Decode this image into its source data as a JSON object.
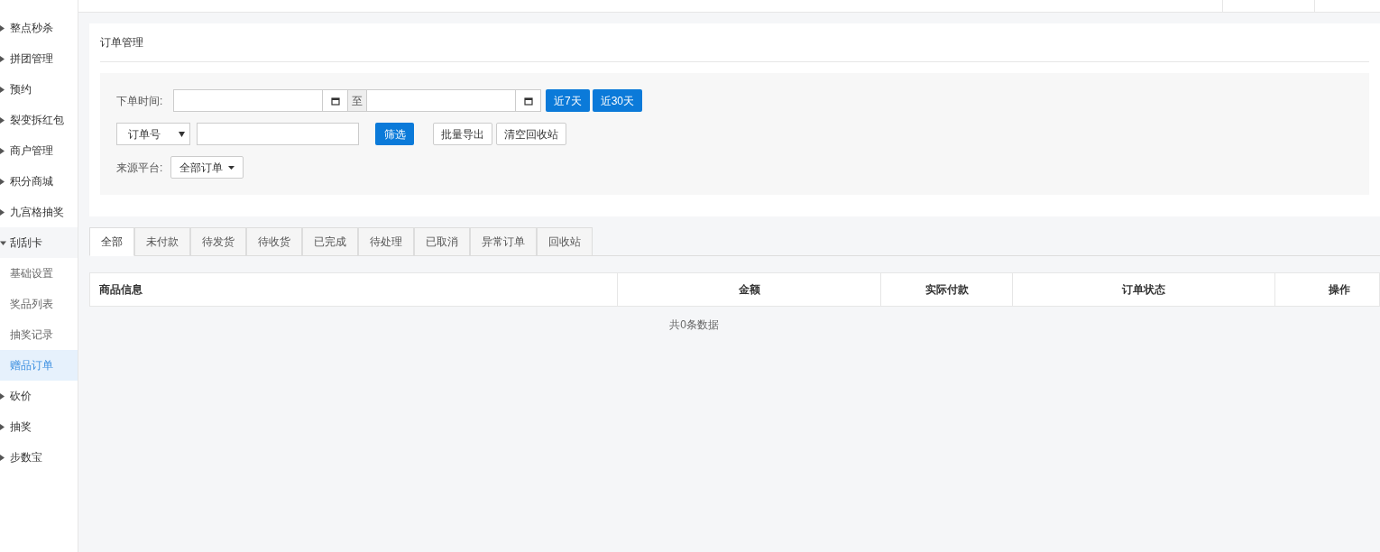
{
  "sidebar": {
    "items": [
      {
        "label": "整点秒杀",
        "expanded": false
      },
      {
        "label": "拼团管理",
        "expanded": false
      },
      {
        "label": "预约",
        "expanded": false
      },
      {
        "label": "裂变拆红包",
        "expanded": false
      },
      {
        "label": "商户管理",
        "expanded": false
      },
      {
        "label": "积分商城",
        "expanded": false
      },
      {
        "label": "九宫格抽奖",
        "expanded": false
      },
      {
        "label": "刮刮卡",
        "expanded": true,
        "children": [
          {
            "label": "基础设置",
            "selected": false
          },
          {
            "label": "奖品列表",
            "selected": false
          },
          {
            "label": "抽奖记录",
            "selected": false
          },
          {
            "label": "赠品订单",
            "selected": true
          }
        ]
      },
      {
        "label": "砍价",
        "expanded": false
      },
      {
        "label": "抽奖",
        "expanded": false
      },
      {
        "label": "步数宝",
        "expanded": false
      }
    ]
  },
  "panel": {
    "title": "订单管理",
    "filters": {
      "time_label": "下单时间:",
      "range_separator": "至",
      "quick_buttons": [
        "近7天",
        "近30天"
      ],
      "search_type": "订单号",
      "filter_button": "筛选",
      "actions": [
        "批量导出",
        "清空回收站"
      ],
      "source_label": "来源平台:",
      "source_value": "全部订单"
    }
  },
  "tabs": [
    {
      "label": "全部",
      "selected": true
    },
    {
      "label": "未付款",
      "selected": false
    },
    {
      "label": "待发货",
      "selected": false
    },
    {
      "label": "待收货",
      "selected": false
    },
    {
      "label": "已完成",
      "selected": false
    },
    {
      "label": "待处理",
      "selected": false
    },
    {
      "label": "已取消",
      "selected": false
    },
    {
      "label": "异常订单",
      "selected": false
    },
    {
      "label": "回收站",
      "selected": false
    }
  ],
  "table": {
    "columns": [
      "商品信息",
      "金额",
      "实际付款",
      "订单状态",
      "操作"
    ],
    "empty_text": "共0条数据"
  }
}
